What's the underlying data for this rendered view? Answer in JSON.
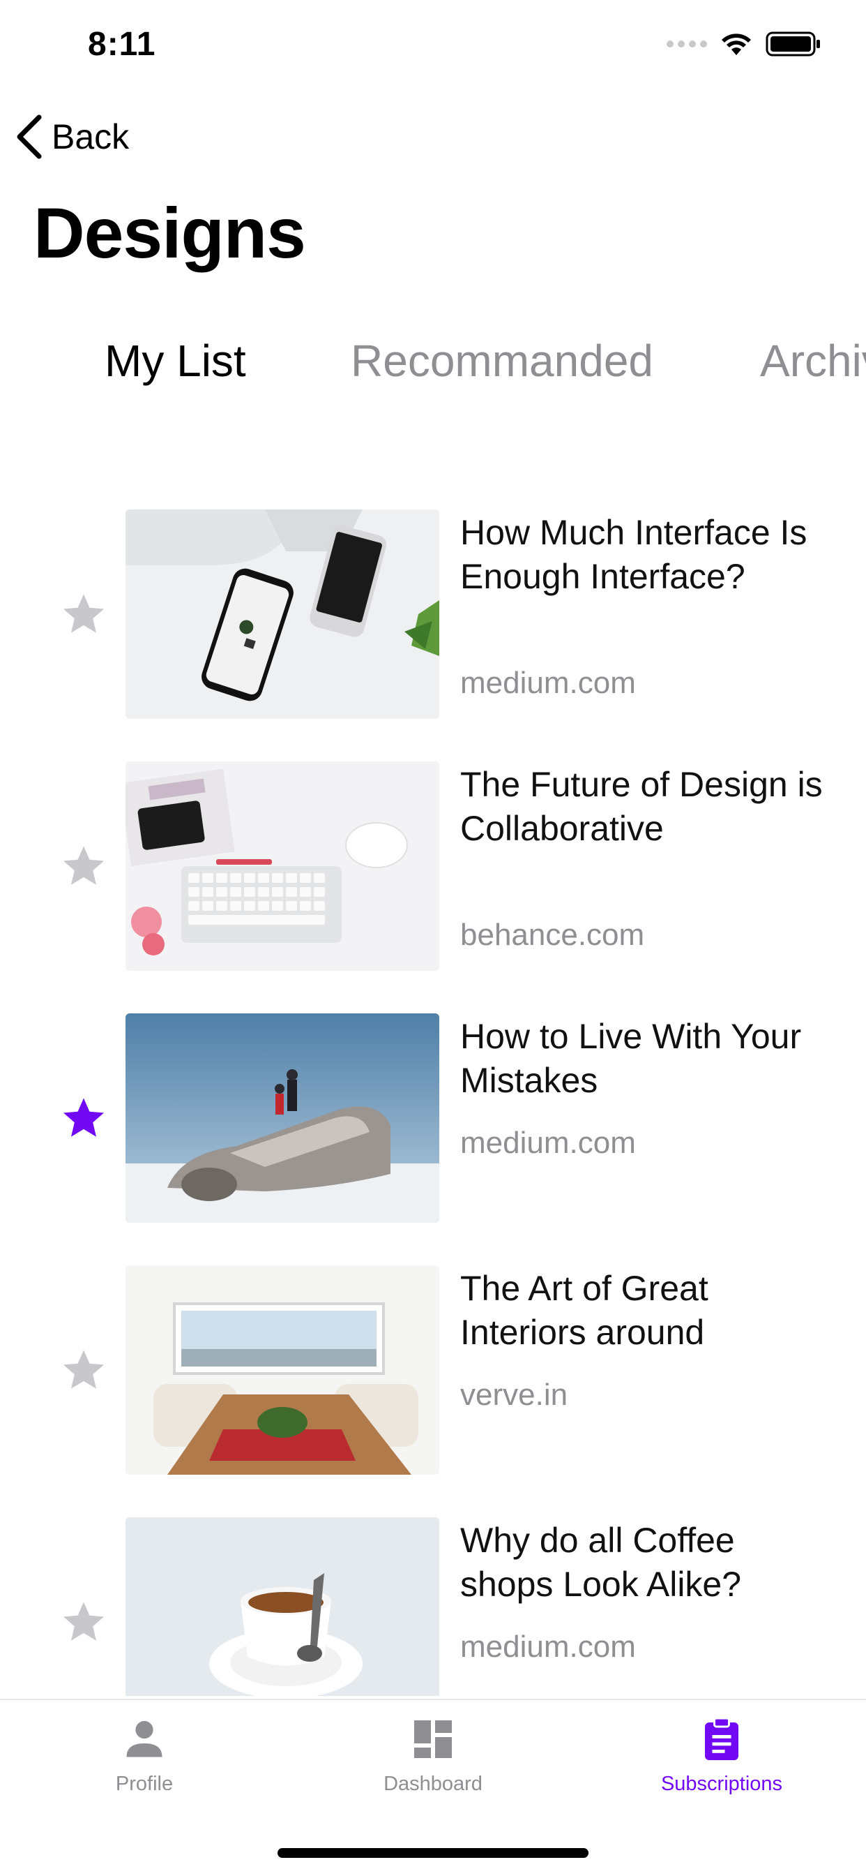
{
  "status_bar": {
    "time": "8:11"
  },
  "nav": {
    "back_label": "Back"
  },
  "title": "Designs",
  "tabs": [
    {
      "label": "My List",
      "active": true
    },
    {
      "label": "Recommanded",
      "active": false
    },
    {
      "label": "Archived",
      "active": false
    }
  ],
  "articles": [
    {
      "title": "How Much Interface Is Enough Interface?",
      "source": "medium.com",
      "starred": false,
      "image": "phone-desk-photo"
    },
    {
      "title": "The Future of Design is Collaborative",
      "source": "behance.com",
      "starred": false,
      "image": "keyboard-desk-photo"
    },
    {
      "title": "How to Live With Your Mistakes",
      "source": "medium.com",
      "starred": true,
      "image": "plane-wreck-photo"
    },
    {
      "title": "The Art of Great Interiors around",
      "source": "verve.in",
      "starred": false,
      "image": "interior-table-photo"
    },
    {
      "title": "Why do all Coffee shops Look Alike?",
      "source": "medium.com",
      "starred": false,
      "image": "coffee-cup-photo"
    }
  ],
  "tab_bar": [
    {
      "label": "Profile",
      "icon": "person-icon",
      "active": false
    },
    {
      "label": "Dashboard",
      "icon": "dashboard-icon",
      "active": false
    },
    {
      "label": "Subscriptions",
      "icon": "clipboard-icon",
      "active": true
    }
  ],
  "colors": {
    "accent": "#7209F5",
    "inactive": "#8E8E93",
    "star_off": "#C7C7CC"
  }
}
